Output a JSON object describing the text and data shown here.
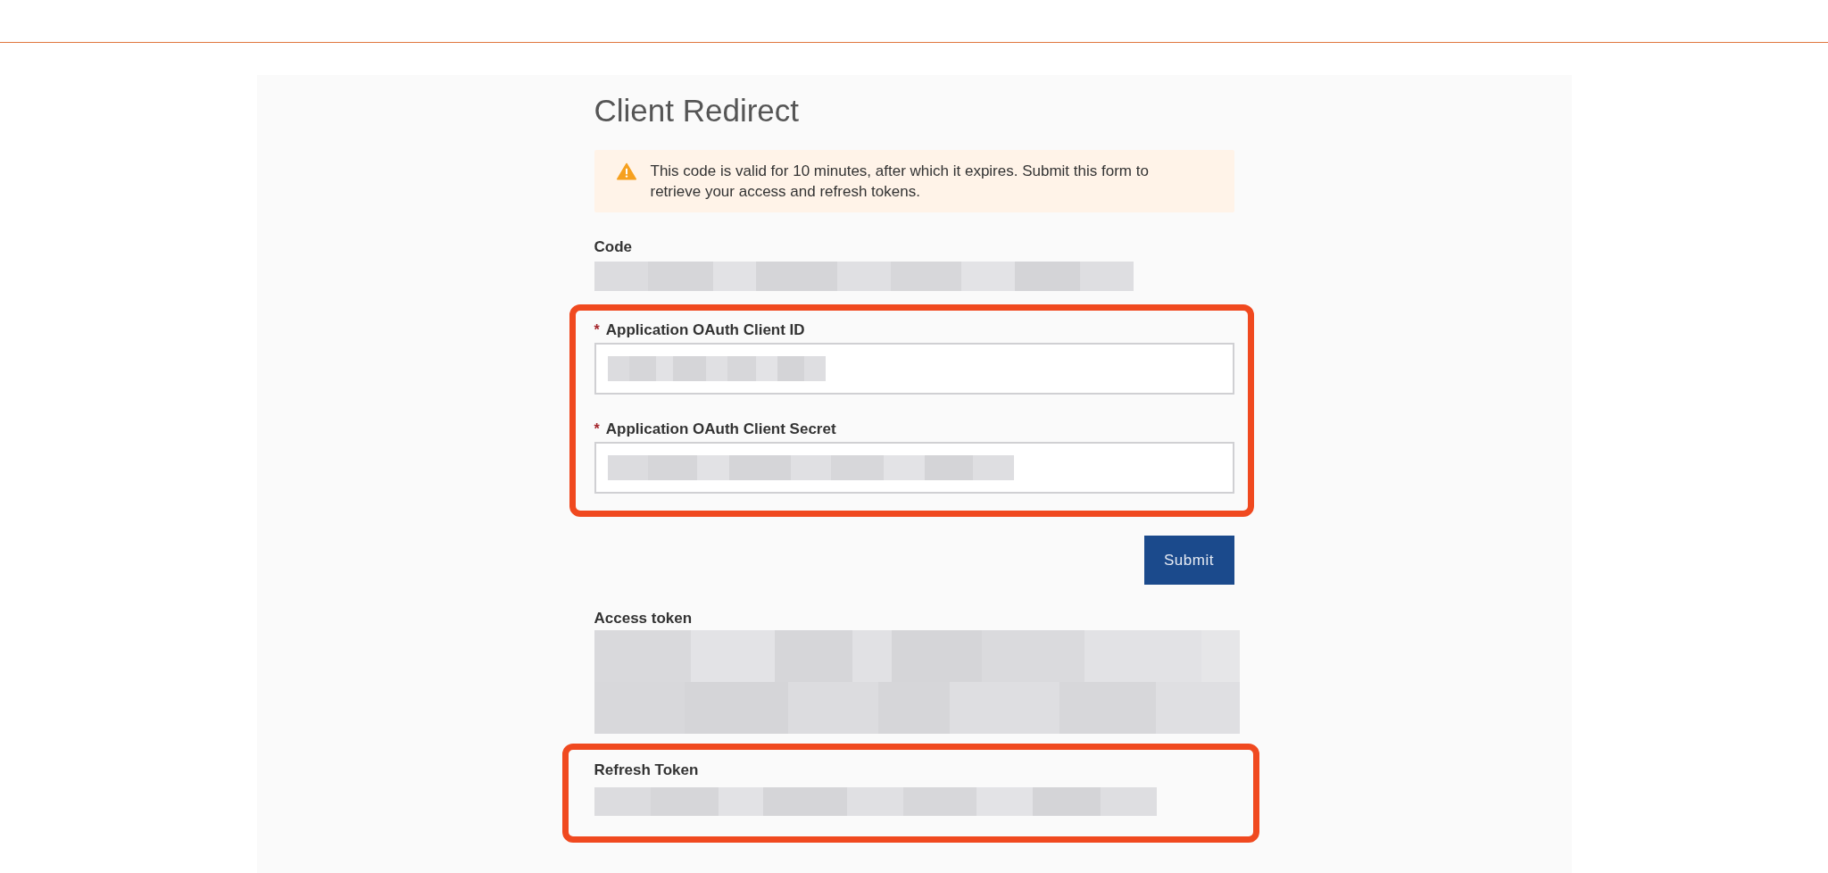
{
  "title": "Client Redirect",
  "alert": {
    "kind": "warning",
    "message": "This code is valid for 10 minutes, after which it expires. Submit this form to retrieve your access and refresh tokens."
  },
  "code": {
    "label": "Code"
  },
  "credentials": {
    "highlighted": true,
    "fields": [
      {
        "label": "Application OAuth Client ID",
        "required_mark": "*"
      },
      {
        "label": "Application OAuth Client Secret",
        "required_mark": "*"
      }
    ]
  },
  "submit_button": "Submit",
  "tokens": [
    {
      "label": "Access token",
      "kind": "multiline",
      "highlighted": false
    },
    {
      "label": "Refresh Token",
      "kind": "single_line",
      "highlighted": true
    }
  ]
}
